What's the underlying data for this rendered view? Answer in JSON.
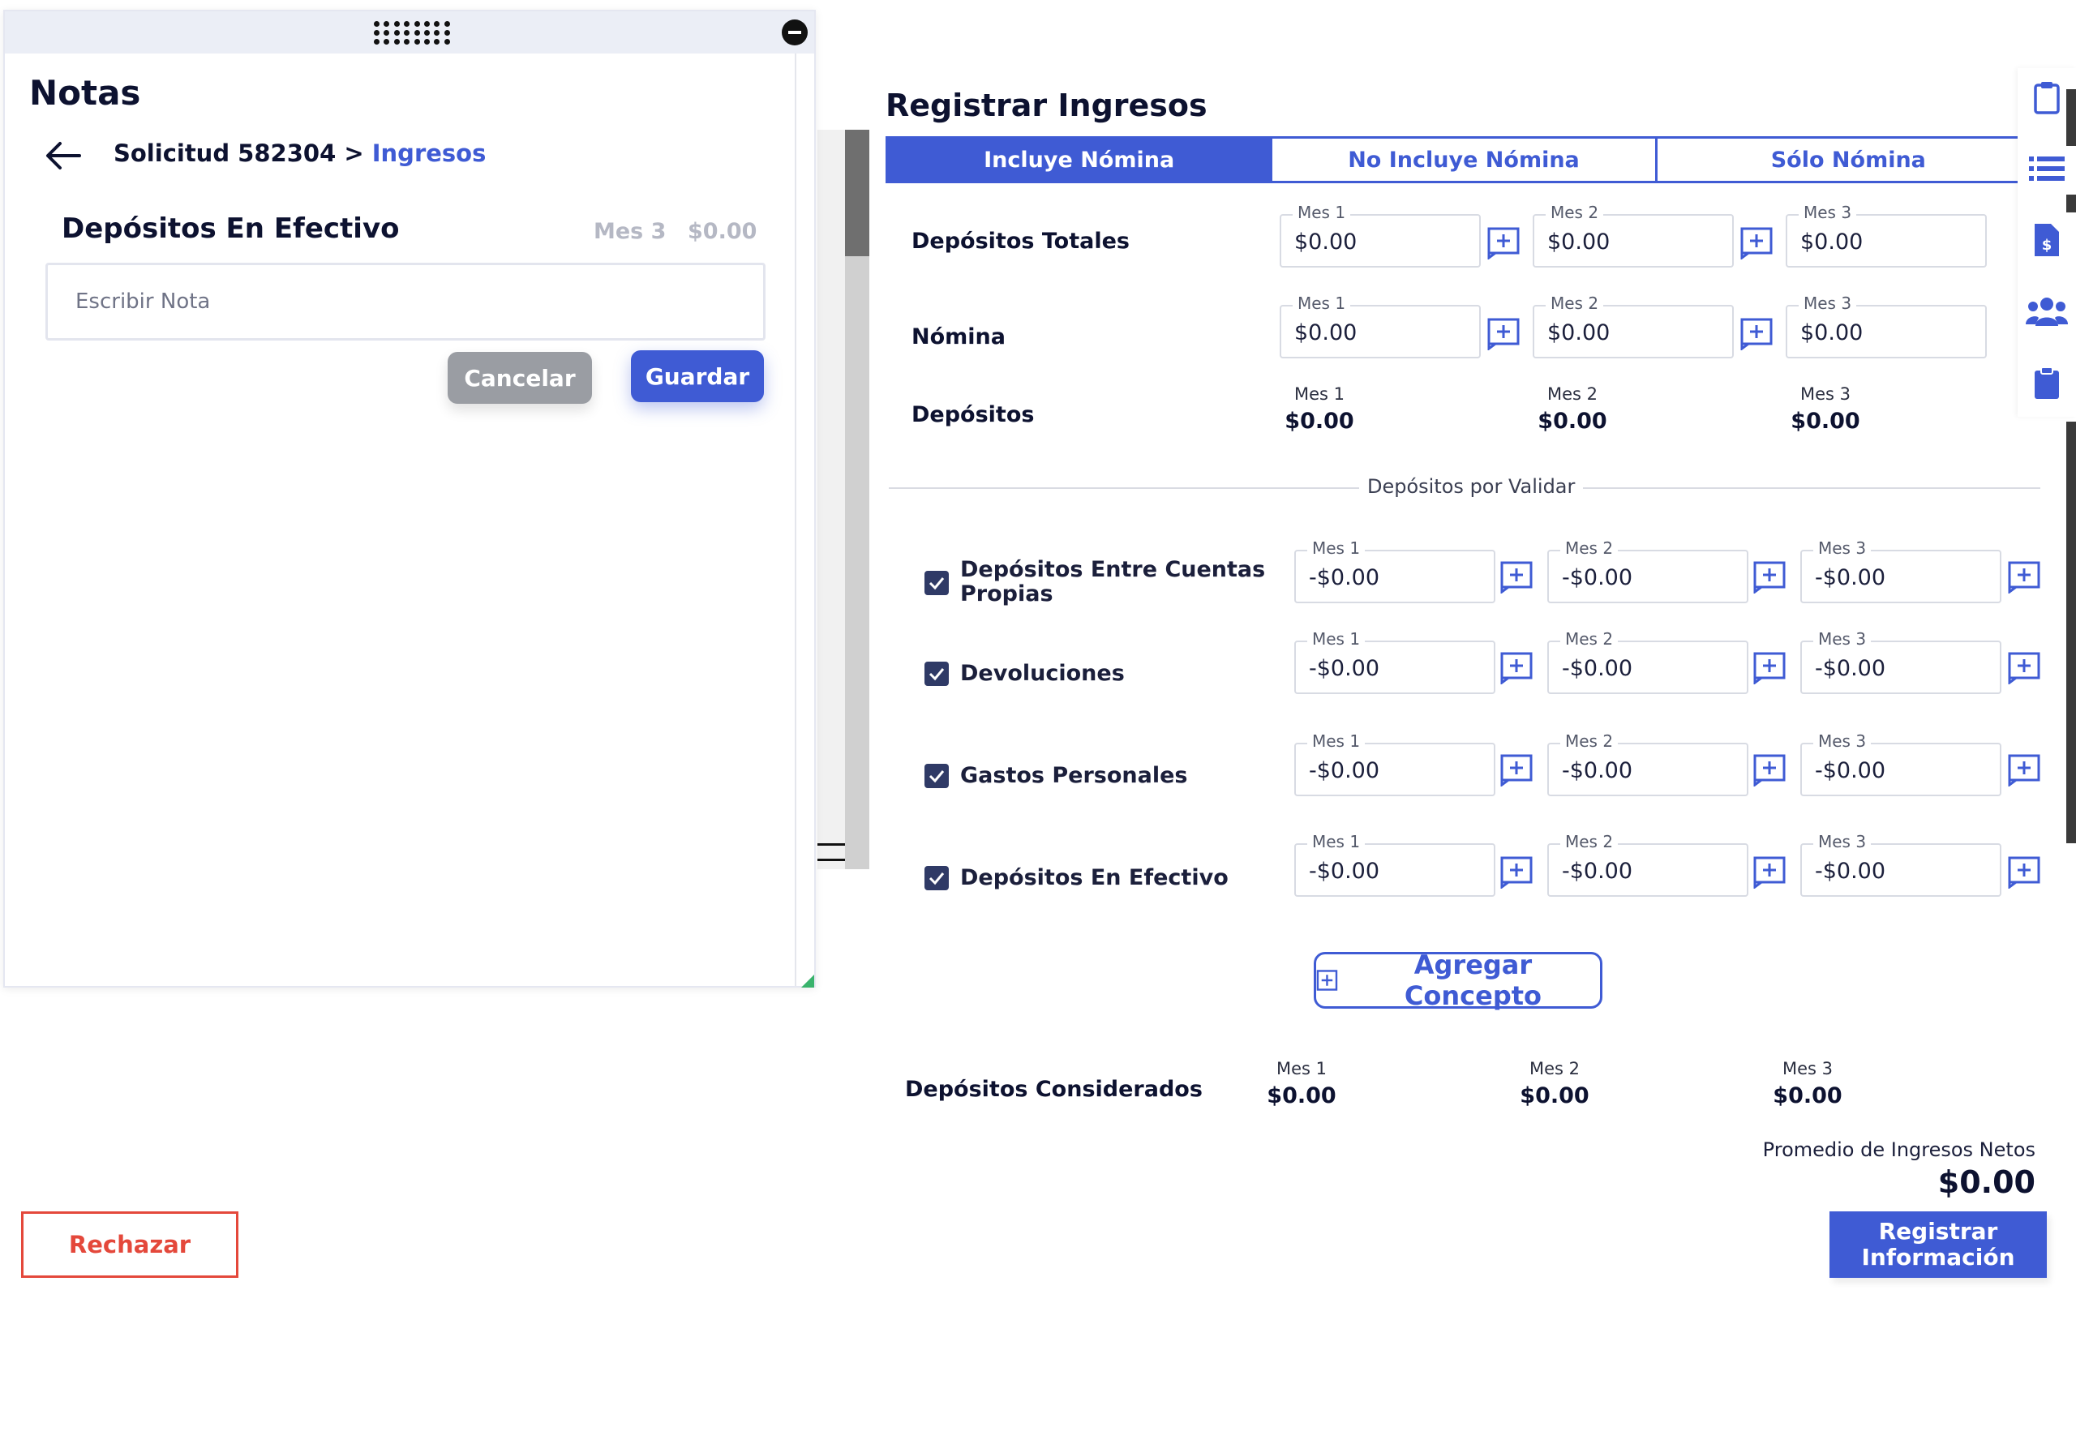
{
  "notes": {
    "title": "Notas",
    "breadcrumb_prefix": "Solicitud 582304 > ",
    "breadcrumb_link": "Ingresos",
    "section": "Depósitos En Efectivo",
    "mes": "Mes 3",
    "amount": "$0.00",
    "input_placeholder": "Escribir Nota",
    "cancel_label": "Cancelar",
    "save_label": "Guardar"
  },
  "form": {
    "title": "Registrar Ingresos",
    "tabs": [
      {
        "label": "Incluye Nómina",
        "active": true
      },
      {
        "label": "No Incluye Nómina",
        "active": false
      },
      {
        "label": "Sólo Nómina",
        "active": false
      }
    ],
    "month_labels": [
      "Mes 1",
      "Mes 2",
      "Mes 3"
    ],
    "depositos_totales": {
      "label": "Depósitos Totales",
      "values": [
        "$0.00",
        "$0.00",
        "$0.00"
      ]
    },
    "nomina": {
      "label": "Nómina",
      "values": [
        "$0.00",
        "$0.00",
        "$0.00"
      ]
    },
    "depositos": {
      "label": "Depósitos",
      "values": [
        "$0.00",
        "$0.00",
        "$0.00"
      ]
    },
    "por_validar_title": "Depósitos por Validar",
    "validar_rows": [
      {
        "label_line1": "Depósitos Entre Cuentas",
        "label_line2": "Propias",
        "checked": true,
        "values": [
          "-$0.00",
          "-$0.00",
          "-$0.00"
        ]
      },
      {
        "label_line1": "Devoluciones",
        "label_line2": "",
        "checked": true,
        "values": [
          "-$0.00",
          "-$0.00",
          "-$0.00"
        ]
      },
      {
        "label_line1": "Gastos Personales",
        "label_line2": "",
        "checked": true,
        "values": [
          "-$0.00",
          "-$0.00",
          "-$0.00"
        ]
      },
      {
        "label_line1": "Depósitos En Efectivo",
        "label_line2": "",
        "checked": true,
        "values": [
          "-$0.00",
          "-$0.00",
          "-$0.00"
        ]
      }
    ],
    "add_concept_label": "Agregar Concepto",
    "considerados": {
      "label": "Depósitos Considerados",
      "values": [
        "$0.00",
        "$0.00",
        "$0.00"
      ]
    },
    "promedio_label": "Promedio de Ingresos Netos",
    "promedio_value": "$0.00",
    "register_line1": "Registrar",
    "register_line2": "Información",
    "reject_label": "Rechazar"
  },
  "colors": {
    "accent": "#3f5bd4",
    "danger": "#e4483b",
    "dark": "#0d1230",
    "checkbox": "#2f3a66"
  },
  "icons": [
    "drag-grip-icon",
    "close-icon",
    "back-arrow-icon",
    "add-comment-icon",
    "checkbox-checked-icon",
    "plus-square-icon",
    "clipboard-icon",
    "list-icon",
    "invoice-dollar-icon",
    "users-icon",
    "clipboard-filled-icon"
  ]
}
